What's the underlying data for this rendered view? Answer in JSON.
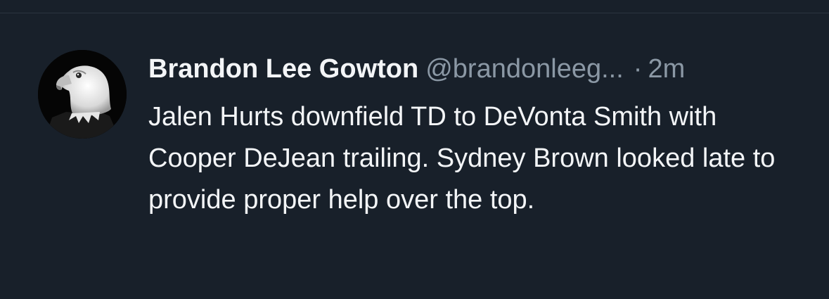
{
  "tweet": {
    "author": {
      "name": "Brandon Lee Gowton",
      "handle": "@brandonleeg...",
      "avatar_icon": "bald-eagle-avatar-icon"
    },
    "separator": "·",
    "time": "2m",
    "text": "Jalen Hurts downfield TD to DeVonta Smith with Cooper DeJean trailing. Sydney Brown looked late to provide proper help over the top."
  },
  "colors": {
    "background": "#18202a",
    "primary_text": "#f3f5f7",
    "secondary_text": "#8b98a5",
    "divider": "#2b3440"
  }
}
